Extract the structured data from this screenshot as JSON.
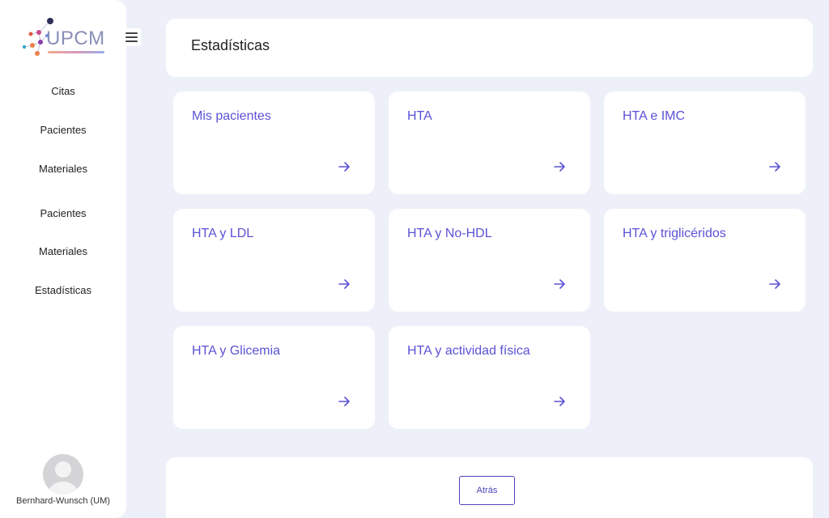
{
  "brand": {
    "logo_text": "UPCM"
  },
  "sidebar": {
    "items": [
      {
        "label": "Citas"
      },
      {
        "label": "Pacientes"
      },
      {
        "label": "Materiales"
      },
      {
        "label": "Pacientes"
      },
      {
        "label": "Materiales"
      },
      {
        "label": "Estadísticas"
      }
    ],
    "user": {
      "name": "Bernhard-Wunsch (UM)"
    }
  },
  "header": {
    "title": "Estadísticas"
  },
  "cards": [
    {
      "title": "Mis pacientes",
      "icon": "arrow-right-icon"
    },
    {
      "title": "HTA",
      "icon": "arrow-right-icon"
    },
    {
      "title": "HTA e IMC",
      "icon": "arrow-right-icon"
    },
    {
      "title": "HTA y LDL",
      "icon": "arrow-right-icon"
    },
    {
      "title": "HTA y No-HDL",
      "icon": "arrow-right-icon"
    },
    {
      "title": "HTA y triglicéridos",
      "icon": "arrow-right-icon"
    },
    {
      "title": "HTA y Glicemia",
      "icon": "arrow-right-icon"
    },
    {
      "title": "HTA y actividad física",
      "icon": "arrow-right-icon"
    }
  ],
  "footer": {
    "back_label": "Atrás"
  },
  "colors": {
    "accent": "#5b52d6",
    "background": "#eef0f9",
    "card": "#ffffff"
  }
}
